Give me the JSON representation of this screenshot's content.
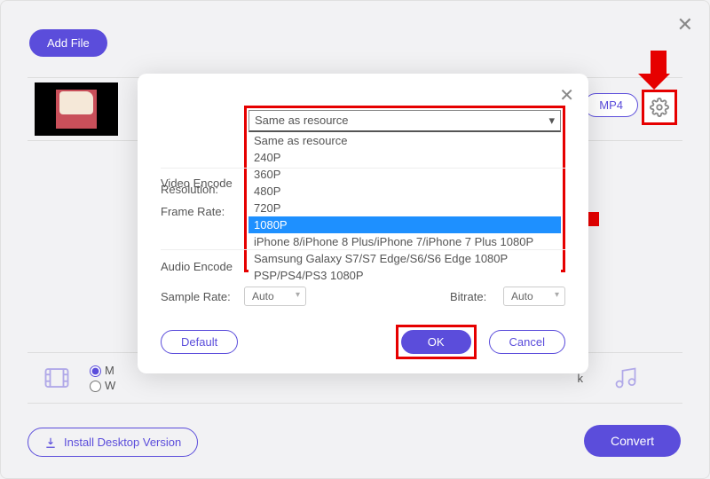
{
  "toolbar": {
    "add_file": "Add File",
    "format": "MP4"
  },
  "dialog": {
    "labels": {
      "resolution": "Resolution:",
      "video_encoder": "Video Encode",
      "frame_rate": "Frame Rate:",
      "audio_encoder": "Audio Encode",
      "sample_rate": "Sample Rate:",
      "bitrate": "Bitrate:"
    },
    "resolution_selected": "Same as resource",
    "resolution_options": [
      "Same as resource",
      "240P",
      "360P",
      "480P",
      "720P",
      "1080P",
      "iPhone 8/iPhone 8 Plus/iPhone 7/iPhone 7 Plus 1080P",
      "Samsung Galaxy S7/S7 Edge/S6/S6 Edge 1080P",
      "PSP/PS4/PS3 1080P"
    ],
    "highlighted_option_index": 5,
    "sample_rate_value": "Auto",
    "bitrate_value": "Auto",
    "buttons": {
      "default": "Default",
      "ok": "OK",
      "cancel": "Cancel"
    }
  },
  "bottom": {
    "radio1_partial": "M",
    "radio2_partial": "W",
    "trail_k": "k"
  },
  "footer": {
    "install": "Install Desktop Version",
    "convert": "Convert"
  }
}
